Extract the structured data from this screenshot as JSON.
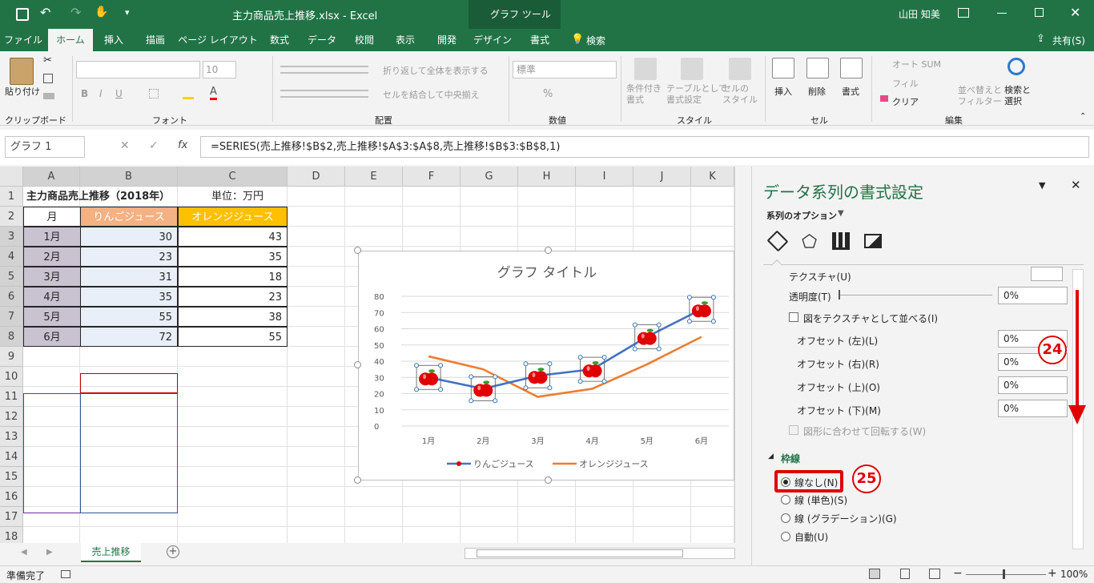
{
  "titlebar": {
    "filename": "主力商品売上推移.xlsx - Excel",
    "context_tool": "グラフ ツール",
    "user": "山田 知美"
  },
  "tabs": [
    "ファイル",
    "ホーム",
    "挿入",
    "描画",
    "ページ レイアウト",
    "数式",
    "データ",
    "校閲",
    "表示",
    "開発",
    "デザイン",
    "書式"
  ],
  "tell_me": "検索",
  "share": "共有(S)",
  "ribbon": {
    "clipboard": {
      "paste": "貼り付け",
      "group": "クリップボード"
    },
    "font": {
      "size": "10",
      "group": "フォント"
    },
    "alignment": {
      "wrap": "折り返して全体を表示する",
      "merge": "セルを結合して中央揃え",
      "group": "配置"
    },
    "number": {
      "format": "標準",
      "group": "数値"
    },
    "styles": {
      "cond": "条件付き\n書式",
      "table": "テーブルとして\n書式設定",
      "cell": "セルの\nスタイル",
      "group": "スタイル"
    },
    "cells": {
      "insert": "挿入",
      "delete": "削除",
      "format": "書式",
      "group": "セル"
    },
    "editing": {
      "autosum": "オート SUM",
      "fill": "フィル",
      "clear": "クリア",
      "sort": "並べ替えと\nフィルター",
      "find": "検索と\n選択",
      "group": "編集"
    }
  },
  "formula_bar": {
    "name_box": "グラフ 1",
    "fx": "fx",
    "formula": "=SERIES(売上推移!$B$2,売上推移!$A$3:$A$8,売上推移!$B$3:$B$8,1)"
  },
  "columns": [
    "A",
    "B",
    "C",
    "D",
    "E",
    "F",
    "G",
    "H",
    "I",
    "J",
    "K"
  ],
  "rows": [
    "1",
    "2",
    "3",
    "4",
    "5",
    "6",
    "7",
    "8",
    "9",
    "10",
    "11",
    "12",
    "13",
    "14",
    "15",
    "16",
    "17",
    "18"
  ],
  "sheet": {
    "title": "主力商品売上推移（2018年）",
    "unit": "単位：万円",
    "headers": [
      "月",
      "りんごジュース",
      "オレンジジュース"
    ],
    "data": [
      [
        "1月",
        "30",
        "43"
      ],
      [
        "2月",
        "23",
        "35"
      ],
      [
        "3月",
        "31",
        "18"
      ],
      [
        "4月",
        "35",
        "23"
      ],
      [
        "5月",
        "55",
        "38"
      ],
      [
        "6月",
        "72",
        "55"
      ]
    ]
  },
  "chart_data": {
    "type": "line",
    "title": "グラフ タイトル",
    "categories": [
      "1月",
      "2月",
      "3月",
      "4月",
      "5月",
      "6月"
    ],
    "series": [
      {
        "name": "りんごジュース",
        "values": [
          30,
          23,
          31,
          35,
          55,
          72
        ],
        "color": "#4472c4",
        "marker": "apple"
      },
      {
        "name": "オレンジジュース",
        "values": [
          43,
          35,
          18,
          23,
          38,
          55
        ],
        "color": "#ed7d31"
      }
    ],
    "ylim": [
      0,
      80
    ],
    "yticks": [
      "0",
      "10",
      "20",
      "30",
      "40",
      "50",
      "60",
      "70",
      "80"
    ],
    "grid": true,
    "legend": "bottom"
  },
  "sheet_tab": "売上推移",
  "panel": {
    "title": "データ系列の書式設定",
    "options": "系列のオプション",
    "texture": "テクスチャ(U)",
    "transparency": "透明度(T)",
    "transparency_val": "0%",
    "tile": "図をテクスチャとして並べる(I)",
    "offsets": [
      {
        "label": "オフセット (左)(L)",
        "val": "0%"
      },
      {
        "label": "オフセット (右)(R)",
        "val": "0%"
      },
      {
        "label": "オフセット (上)(O)",
        "val": "0%"
      },
      {
        "label": "オフセット (下)(M)",
        "val": "0%"
      }
    ],
    "rotate": "図形に合わせて回転する(W)",
    "border_section": "枠線",
    "radios": [
      "線なし(N)",
      "線 (単色)(S)",
      "線 (グラデーション)(G)",
      "自動(U)"
    ],
    "annot1": "24",
    "annot2": "25"
  },
  "status": {
    "ready": "準備完了",
    "zoom": "100%"
  },
  "colors": {
    "excel_green": "#217346",
    "apple_red": "#e00000",
    "header_salmon": "#f4b183",
    "header_orange": "#ffc000"
  }
}
